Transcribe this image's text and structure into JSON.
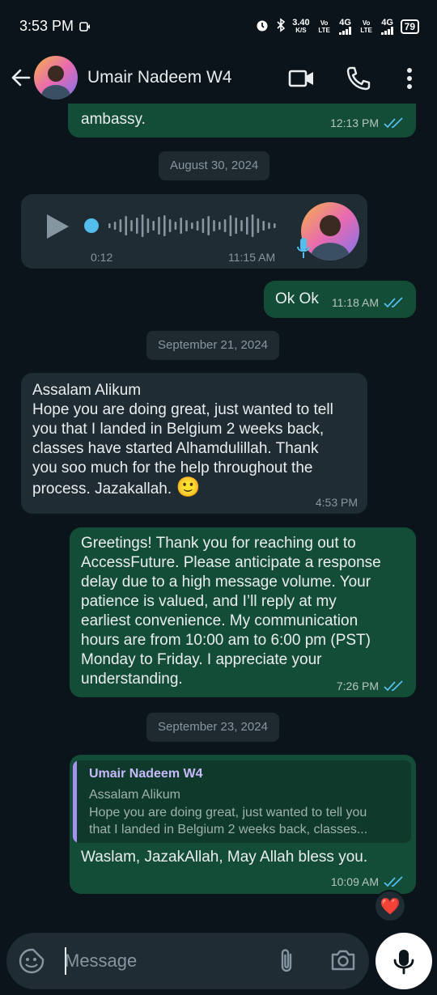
{
  "status_bar": {
    "time": "3:53 PM",
    "net_speed_value": "3.40",
    "net_speed_unit": "K/S",
    "sim1_label": "Vo LTE",
    "sim1_net": "4G",
    "sim2_label": "Vo LTE",
    "sim2_net": "4G",
    "battery": "79"
  },
  "header": {
    "contact_name": "Umair Nadeem W4"
  },
  "messages": {
    "m0": {
      "text": "ambassy.",
      "time": "12:13 PM"
    },
    "date1": "August 30, 2024",
    "voice": {
      "duration": "0:12",
      "time": "11:15 AM"
    },
    "m2": {
      "text": "Ok Ok",
      "time": "11:18 AM"
    },
    "date2": "September 21, 2024",
    "m3": {
      "line1": "Assalam Alikum",
      "line2": "Hope you are doing great, just wanted to tell",
      "line3": "you that I landed in Belgium 2 weeks back,",
      "line4": "classes have started Alhamdulillah. Thank",
      "line5": "you soo much for the help throughout the",
      "line6": "process. Jazakallah.",
      "emoji": "🙂",
      "time": "4:53 PM"
    },
    "m4": {
      "line1": "Greetings! Thank you for reaching out to",
      "line2": "AccessFuture. Please anticipate a response",
      "line3": "delay due to a high message volume. Your",
      "line4": "patience is valued, and I’ll reply at my",
      "line5": "earliest convenience. My communication",
      "line6": "hours are from 10:00 am to 6:00 pm (PST)",
      "line7": "Monday to Friday. I appreciate your",
      "line8": "understanding.",
      "time": "7:26 PM"
    },
    "date3": "September 23, 2024",
    "m5": {
      "quote_name": "Umair Nadeem W4",
      "quote_line1": "Assalam Alikum",
      "quote_line2": "Hope you are doing great, just wanted to tell you",
      "quote_line3": "that I landed in Belgium 2 weeks back, classes...",
      "text": "Waslam, JazakAllah, May Allah bless you.",
      "time": "10:09 AM",
      "reaction": "❤️"
    }
  },
  "composer": {
    "placeholder": "Message"
  },
  "colors": {
    "background": "#0b141a",
    "outgoing_bubble": "#144d37",
    "incoming_bubble": "#202c33",
    "read_ticks": "#53bdeb"
  }
}
